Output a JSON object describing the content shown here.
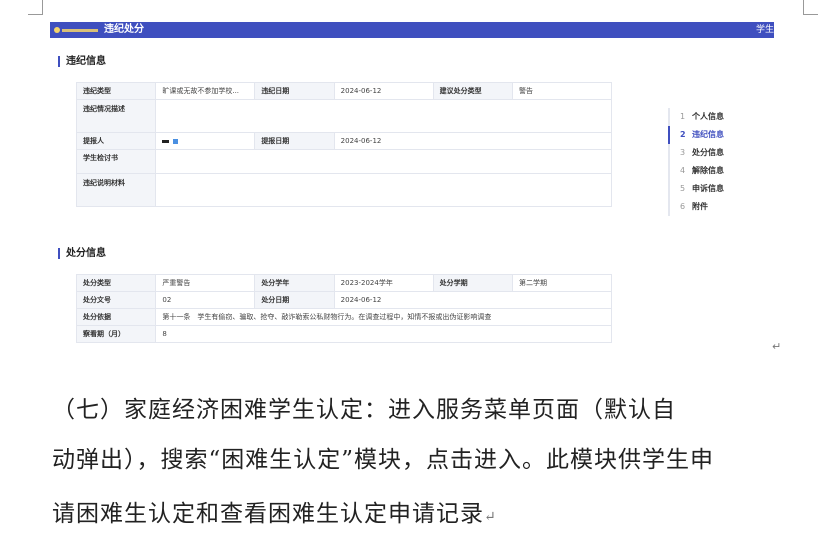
{
  "screenshot": {
    "app_title": "违纪处分",
    "topbar_right": "学生",
    "violation_section": {
      "title": "违纪信息",
      "rows": {
        "type_label": "违纪类型",
        "type_value": "旷课或无故不参加学校...",
        "date_label": "违纪日期",
        "date_value": "2024-06-12",
        "suggest_label": "建议处分类型",
        "suggest_value": "警告",
        "desc_label": "违纪情况描述",
        "desc_value": "",
        "reporter_label": "提报人",
        "report_date_label": "提报日期",
        "report_date_value": "2024-06-12",
        "review_label": "学生检讨书",
        "review_value": "",
        "material_label": "违纪说明材料",
        "material_value": ""
      }
    },
    "steps": [
      {
        "num": "1",
        "label": "个人信息"
      },
      {
        "num": "2",
        "label": "违纪信息"
      },
      {
        "num": "3",
        "label": "处分信息"
      },
      {
        "num": "4",
        "label": "解除信息"
      },
      {
        "num": "5",
        "label": "申诉信息"
      },
      {
        "num": "6",
        "label": "附件"
      }
    ],
    "active_step": "2",
    "punish_section": {
      "title": "处分信息",
      "rows": {
        "type_label": "处分类型",
        "type_value": "严重警告",
        "year_label": "处分学年",
        "year_value": "2023-2024学年",
        "term_label": "处分学期",
        "term_value": "第二学期",
        "doc_label": "处分文号",
        "doc_value": "02",
        "pdate_label": "处分日期",
        "pdate_value": "2024-06-12",
        "basis_label": "处分依据",
        "basis_value": "第十一条　学生有偷窃、骗取、抢夺、敲诈勒索公私财物行为。在调查过程中，知情不报或出伪证影响调查",
        "period_label": "察看期（月）",
        "period_value": "8"
      }
    }
  },
  "paragraph": {
    "line1": "（七）家庭经济困难学生认定：进入服务菜单页面（默认自",
    "line2": "动弹出），搜索“困难生认定”模块，点击进入。此模块供学生申",
    "line3": "请困难生认定和查看困难生认定申请记录"
  },
  "colors": {
    "topbar": "#3f4fbf",
    "accent": "#3f4fbf"
  }
}
